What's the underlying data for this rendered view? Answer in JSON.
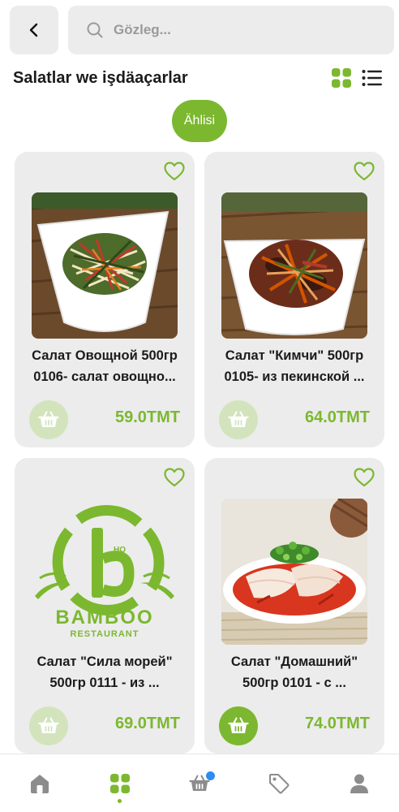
{
  "search": {
    "placeholder": "Gözleg..."
  },
  "section": {
    "title": "Salatlar we işdäaçarlar"
  },
  "filters": [
    {
      "label": "Ählisi",
      "selected": true
    }
  ],
  "colors": {
    "accent": "#7cb82f",
    "accent_light": "#d3e4bd",
    "card_bg": "#ececec",
    "badge": "#2d8cf0"
  },
  "products": [
    {
      "line1": "Салат Овощной 500гр",
      "line2": "0106- салат овощно...",
      "price": "59.0TMT",
      "image": "vegetable-salad-photo",
      "in_cart": false
    },
    {
      "line1": "Салат \"Кимчи\" 500гр",
      "line2": "0105- из пекинской ...",
      "price": "64.0TMT",
      "image": "kimchi-salad-photo",
      "in_cart": false
    },
    {
      "line1": "Салат \"Сила морей\"",
      "line2": "500гр  0111 - из ...",
      "price": "69.0TMT",
      "image": "bamboo-restaurant-logo",
      "in_cart": false
    },
    {
      "line1": "Салат \"Домашний\"",
      "line2": "500гр  0101 - с ...",
      "price": "74.0TMT",
      "image": "homemade-salad-photo",
      "in_cart": true
    }
  ],
  "logo": {
    "brand": "BAMBOO",
    "sub": "RESTAURANT",
    "mark": "HO GO"
  },
  "nav": [
    {
      "icon": "home-icon",
      "active": false
    },
    {
      "icon": "categories-icon",
      "active": true
    },
    {
      "icon": "cart-icon",
      "active": false,
      "badge": true
    },
    {
      "icon": "tag-icon",
      "active": false
    },
    {
      "icon": "profile-icon",
      "active": false
    }
  ]
}
